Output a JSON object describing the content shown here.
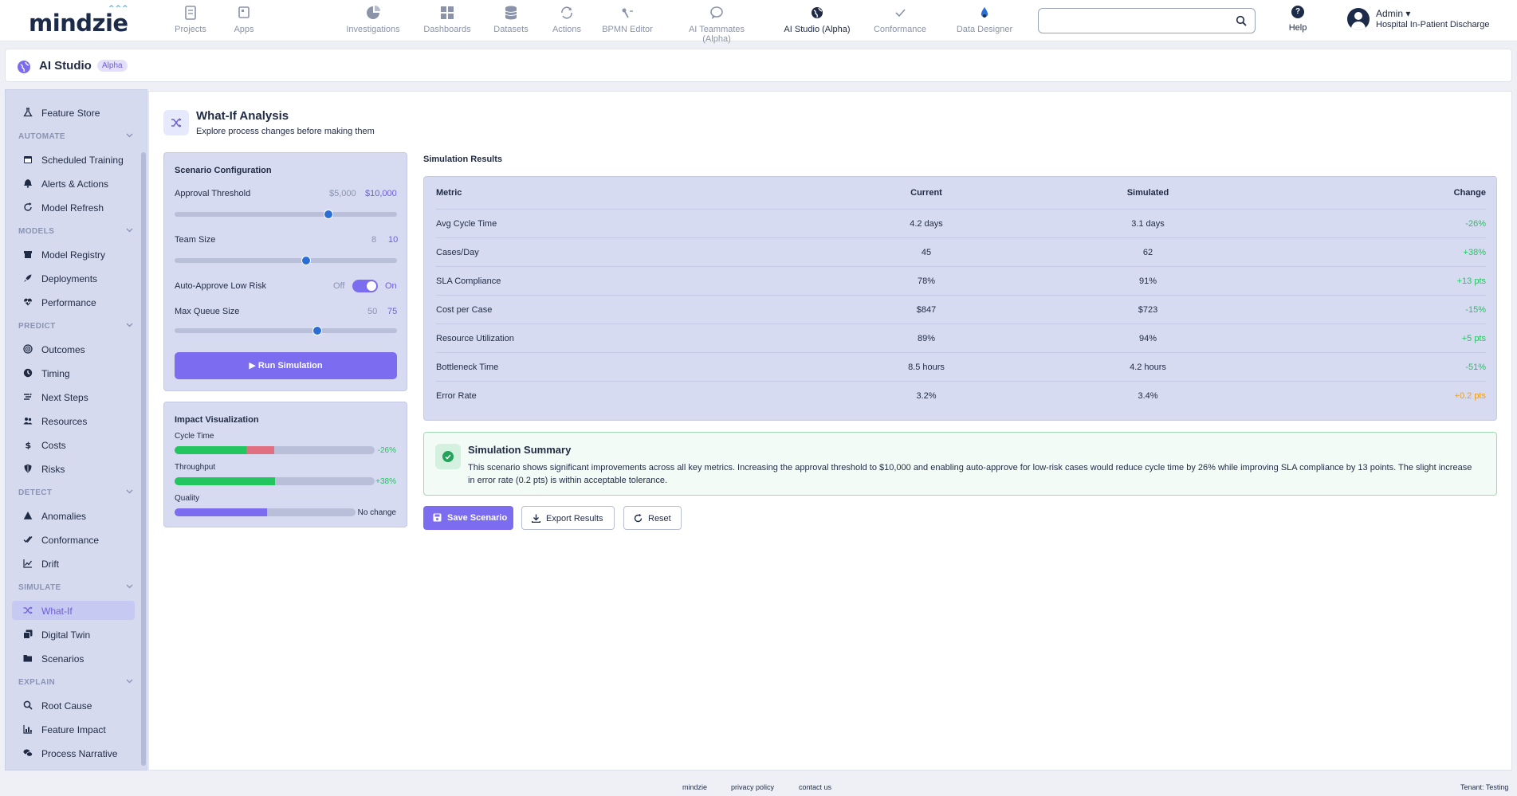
{
  "brand": {
    "name": "mindzie"
  },
  "nav": {
    "items": [
      {
        "label": "Projects",
        "icon": "projects-icon"
      },
      {
        "label": "Apps",
        "icon": "apps-icon"
      },
      {
        "label": "Investigations",
        "icon": "investigations-icon"
      },
      {
        "label": "Dashboards",
        "icon": "dashboards-icon"
      },
      {
        "label": "Datasets",
        "icon": "datasets-icon"
      },
      {
        "label": "Actions",
        "icon": "actions-icon"
      },
      {
        "label": "BPMN Editor",
        "icon": "bpmn-icon"
      },
      {
        "label": "AI Teammates (Alpha)",
        "icon": "chat-icon"
      },
      {
        "label": "AI Studio (Alpha)",
        "icon": "globe-icon",
        "active": true
      },
      {
        "label": "Conformance",
        "icon": "check-icon"
      },
      {
        "label": "Data Designer",
        "icon": "drop-icon"
      }
    ],
    "search_placeholder": "",
    "help_label": "Help",
    "user_name": "Admin",
    "user_tenant": "Hospital In-Patient Discharge"
  },
  "titlebar": {
    "title": "AI Studio",
    "badge": "Alpha"
  },
  "sidebar": {
    "items": [
      {
        "label": "Feature Store",
        "icon": "flask-icon"
      },
      {
        "group": "AUTOMATE"
      },
      {
        "label": "Scheduled Training",
        "icon": "calendar-icon"
      },
      {
        "label": "Alerts & Actions",
        "icon": "bell-icon"
      },
      {
        "label": "Model Refresh",
        "icon": "refresh-icon"
      },
      {
        "group": "MODELS"
      },
      {
        "label": "Model Registry",
        "icon": "archive-icon"
      },
      {
        "label": "Deployments",
        "icon": "rocket-icon"
      },
      {
        "label": "Performance",
        "icon": "heart-icon"
      },
      {
        "group": "PREDICT"
      },
      {
        "label": "Outcomes",
        "icon": "target-icon"
      },
      {
        "label": "Timing",
        "icon": "clock-icon"
      },
      {
        "label": "Next Steps",
        "icon": "steps-icon"
      },
      {
        "label": "Resources",
        "icon": "users-icon"
      },
      {
        "label": "Costs",
        "icon": "dollar-icon"
      },
      {
        "label": "Risks",
        "icon": "shield-icon"
      },
      {
        "group": "DETECT"
      },
      {
        "label": "Anomalies",
        "icon": "warning-icon"
      },
      {
        "label": "Conformance",
        "icon": "check-double-icon"
      },
      {
        "label": "Drift",
        "icon": "line-chart-icon"
      },
      {
        "group": "SIMULATE"
      },
      {
        "label": "What-If",
        "icon": "shuffle-icon",
        "active": true
      },
      {
        "label": "Digital Twin",
        "icon": "clone-icon"
      },
      {
        "label": "Scenarios",
        "icon": "folder-icon"
      },
      {
        "group": "EXPLAIN"
      },
      {
        "label": "Root Cause",
        "icon": "search-icon"
      },
      {
        "label": "Feature Impact",
        "icon": "bar-chart-icon"
      },
      {
        "label": "Process Narrative",
        "icon": "comments-icon"
      }
    ]
  },
  "page": {
    "title": "What-If Analysis",
    "subtitle": "Explore process changes before making them"
  },
  "config": {
    "title": "Scenario Configuration",
    "approval": {
      "label": "Approval Threshold",
      "current": "$5,000",
      "new": "$10,000",
      "position": 0.69
    },
    "team": {
      "label": "Team Size",
      "current": "8",
      "new": "10",
      "position": 0.59
    },
    "auto": {
      "label": "Auto-Approve Low Risk",
      "off": "Off",
      "on": "On",
      "enabled": true
    },
    "queue": {
      "label": "Max Queue Size",
      "current": "50",
      "new": "75",
      "position": 0.64
    },
    "run_label": "Run Simulation"
  },
  "impact": {
    "title": "Impact Visualization",
    "bars": [
      {
        "label": "Cycle Time",
        "value": "-26%",
        "green": 0.36,
        "red": 0.14,
        "color": "#22c55e"
      },
      {
        "label": "Throughput",
        "value": "+38%",
        "green": 0.5,
        "red": 0,
        "color": "#22c55e"
      },
      {
        "label": "Quality",
        "value": "No change",
        "purple": 0.51,
        "color": "#1f2a44"
      }
    ]
  },
  "results": {
    "title": "Simulation Results",
    "headers": [
      "Metric",
      "Current",
      "Simulated",
      "Change"
    ],
    "rows": [
      {
        "metric": "Avg Cycle Time",
        "current": "4.2 days",
        "simulated": "3.1 days",
        "change": "-26%",
        "color": "#22c55e"
      },
      {
        "metric": "Cases/Day",
        "current": "45",
        "simulated": "62",
        "change": "+38%",
        "color": "#22c55e"
      },
      {
        "metric": "SLA Compliance",
        "current": "78%",
        "simulated": "91%",
        "change": "+13 pts",
        "color": "#22c55e"
      },
      {
        "metric": "Cost per Case",
        "current": "$847",
        "simulated": "$723",
        "change": "-15%",
        "color": "#22c55e"
      },
      {
        "metric": "Resource Utilization",
        "current": "89%",
        "simulated": "94%",
        "change": "+5 pts",
        "color": "#22c55e"
      },
      {
        "metric": "Bottleneck Time",
        "current": "8.5 hours",
        "simulated": "4.2 hours",
        "change": "-51%",
        "color": "#22c55e"
      },
      {
        "metric": "Error Rate",
        "current": "3.2%",
        "simulated": "3.4%",
        "change": "+0.2 pts",
        "color": "#f59e0b"
      }
    ]
  },
  "summary": {
    "title": "Simulation Summary",
    "text": "This scenario shows significant improvements across all key metrics. Increasing the approval threshold to $10,000 and enabling auto-approve for low-risk cases would reduce cycle time by 26% while improving SLA compliance by 13 points. The slight increase in error rate (0.2 pts) is within acceptable tolerance."
  },
  "actions": {
    "save": "Save Scenario",
    "export": "Export Results",
    "reset": "Reset"
  },
  "footer": {
    "brand": "mindzie",
    "privacy": "privacy policy",
    "contact": "contact us",
    "tenant": "Tenant: Testing"
  },
  "colors": {
    "accent": "#7b6cf0",
    "positive": "#22c55e",
    "warning": "#f59e0b",
    "negative": "#e07080",
    "sidebar_bg": "#d5daef"
  }
}
